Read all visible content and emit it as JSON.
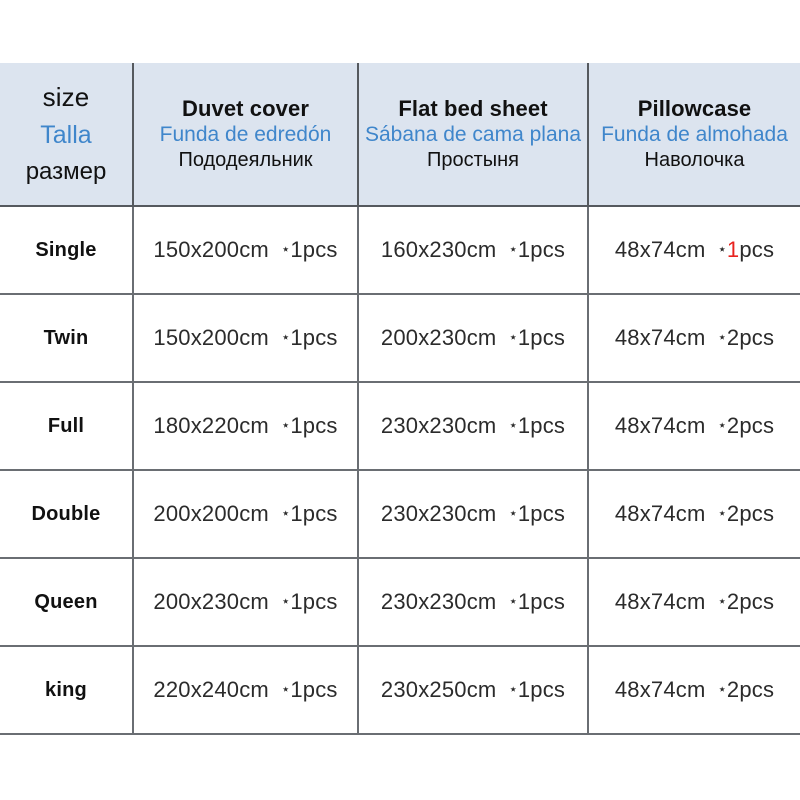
{
  "table": {
    "header": {
      "size_column": {
        "en": "size",
        "es": "Talla",
        "ru": "размер"
      },
      "columns": [
        {
          "en": "Duvet cover",
          "es": "Funda de edredón",
          "ru": "Пододеяльник"
        },
        {
          "en": "Flat bed sheet",
          "es": "Sábana de cama plana",
          "ru": "Простыня"
        },
        {
          "en": "Pillowcase",
          "es": "Funda de almohada",
          "ru": "Наволочка"
        }
      ]
    },
    "rows": [
      {
        "size": "Single",
        "duvet": {
          "dim": "150x200cm",
          "qty": "1pcs",
          "highlight": false
        },
        "flat": {
          "dim": "160x230cm",
          "qty": "1pcs",
          "highlight": false
        },
        "pillow": {
          "dim": "48x74cm",
          "qty": "1pcs",
          "highlight": true,
          "highlight_char": "1",
          "qty_rest": "pcs"
        }
      },
      {
        "size": "Twin",
        "duvet": {
          "dim": "150x200cm",
          "qty": "1pcs",
          "highlight": false
        },
        "flat": {
          "dim": "200x230cm",
          "qty": "1pcs",
          "highlight": false
        },
        "pillow": {
          "dim": "48x74cm",
          "qty": "2pcs",
          "highlight": false
        }
      },
      {
        "size": "Full",
        "duvet": {
          "dim": "180x220cm",
          "qty": "1pcs",
          "highlight": false
        },
        "flat": {
          "dim": "230x230cm",
          "qty": "1pcs",
          "highlight": false
        },
        "pillow": {
          "dim": "48x74cm",
          "qty": "2pcs",
          "highlight": false
        }
      },
      {
        "size": "Double",
        "duvet": {
          "dim": "200x200cm",
          "qty": "1pcs",
          "highlight": false
        },
        "flat": {
          "dim": "230x230cm",
          "qty": "1pcs",
          "highlight": false
        },
        "pillow": {
          "dim": "48x74cm",
          "qty": "2pcs",
          "highlight": false
        }
      },
      {
        "size": "Queen",
        "duvet": {
          "dim": "200x230cm",
          "qty": "1pcs",
          "highlight": false
        },
        "flat": {
          "dim": "230x230cm",
          "qty": "1pcs",
          "highlight": false
        },
        "pillow": {
          "dim": "48x74cm",
          "qty": "2pcs",
          "highlight": false
        }
      },
      {
        "size": "king",
        "duvet": {
          "dim": "220x240cm",
          "qty": "1pcs",
          "highlight": false
        },
        "flat": {
          "dim": "230x250cm",
          "qty": "1pcs",
          "highlight": false
        },
        "pillow": {
          "dim": "48x74cm",
          "qty": "2pcs",
          "highlight": false
        }
      }
    ],
    "quantity_prefix": "⋆",
    "colors": {
      "header_background": "#dce4ef",
      "spanish_text": "#3f86cb",
      "english_text": "#111111",
      "russian_text": "#111111",
      "highlight": "#e8231f",
      "border": "#6a6e73",
      "page_background": "#ffffff"
    }
  }
}
